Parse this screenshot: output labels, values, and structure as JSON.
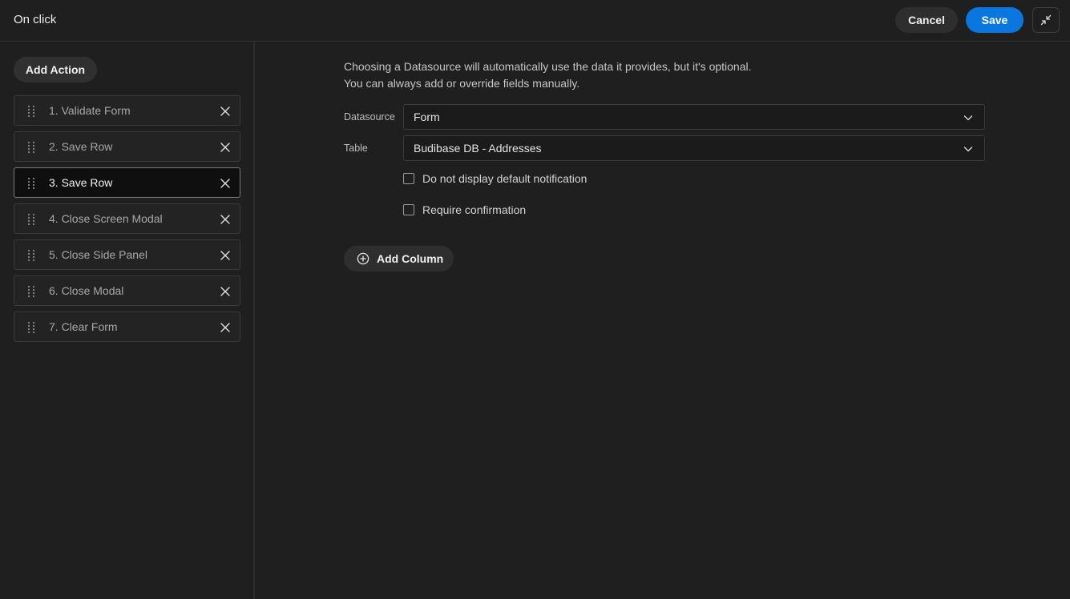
{
  "header": {
    "title": "On click",
    "cancel_label": "Cancel",
    "save_label": "Save",
    "collapse_icon": "minimize-icon"
  },
  "sidebar": {
    "add_action_label": "Add Action",
    "actions": [
      {
        "label": "1. Validate Form",
        "selected": false
      },
      {
        "label": "2. Save Row",
        "selected": false
      },
      {
        "label": "3. Save Row",
        "selected": true
      },
      {
        "label": "4. Close Screen Modal",
        "selected": false
      },
      {
        "label": "5. Close Side Panel",
        "selected": false
      },
      {
        "label": "6. Close Modal",
        "selected": false
      },
      {
        "label": "7. Clear Form",
        "selected": false
      }
    ]
  },
  "main": {
    "description_line1": "Choosing a Datasource will automatically use the data it provides, but it's optional.",
    "description_line2": "You can always add or override fields manually.",
    "datasource": {
      "label": "Datasource",
      "value": "Form"
    },
    "table": {
      "label": "Table",
      "value": "Budibase DB - Addresses"
    },
    "checkbox_notification": {
      "label": "Do not display default notification",
      "checked": false
    },
    "checkbox_confirmation": {
      "label": "Require confirmation",
      "checked": false
    },
    "add_column_label": "Add Column"
  },
  "colors": {
    "background": "#1f1f1f",
    "accent": "#0a77e0"
  }
}
